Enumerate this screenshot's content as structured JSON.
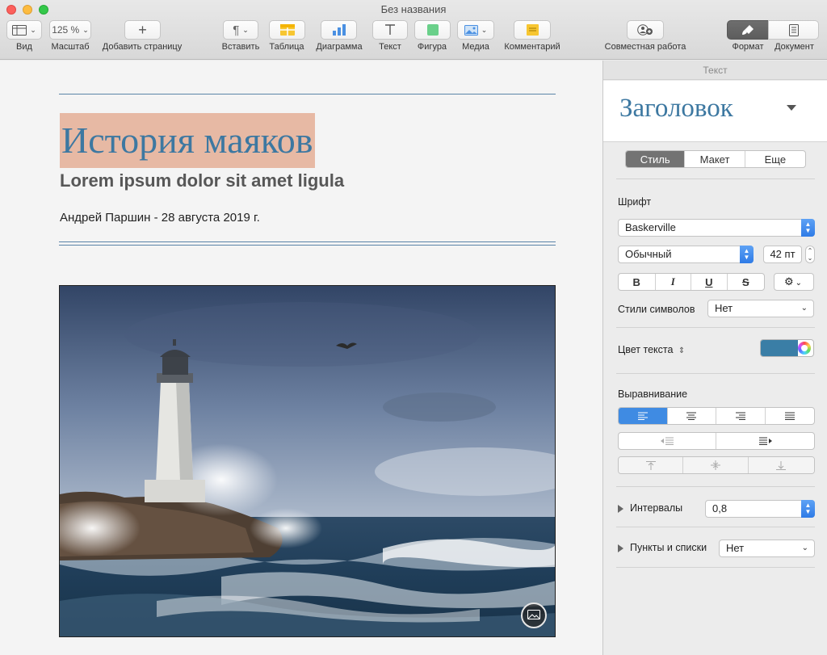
{
  "window": {
    "title": "Без названия"
  },
  "toolbar": {
    "view_label": "Вид",
    "zoom_value": "125 %",
    "zoom_label": "Масштаб",
    "add_page_label": "Добавить страницу",
    "insert_label": "Вставить",
    "table_label": "Таблица",
    "chart_label": "Диаграмма",
    "text_label": "Текст",
    "shape_label": "Фигура",
    "media_label": "Медиа",
    "comment_label": "Комментарий",
    "collab_label": "Совместная работа",
    "format_label": "Формат",
    "document_label": "Документ"
  },
  "document": {
    "title": "История маяков",
    "subtitle": "Lorem ipsum dolor sit amet ligula",
    "author_line": "Андрей Паршин - 28 августа 2019 г."
  },
  "inspector": {
    "header": "Текст",
    "paragraph_style": "Заголовок",
    "tabs": [
      "Стиль",
      "Макет",
      "Еще"
    ],
    "active_tab": 0,
    "font_section": "Шрифт",
    "font_family": "Baskerville",
    "font_style": "Обычный",
    "font_size": "42 пт",
    "bold": "B",
    "italic": "I",
    "underline": "U",
    "strike": "S",
    "char_styles_label": "Стили символов",
    "char_styles_value": "Нет",
    "text_color_label": "Цвет текста",
    "text_color": "#3a7ea6",
    "alignment_section": "Выравнивание",
    "spacing_label": "Интервалы",
    "spacing_value": "0,8",
    "lists_label": "Пункты и списки",
    "lists_value": "Нет"
  },
  "colors": {
    "accent": "#3d78a1",
    "title_highlight": "#e7b9a4",
    "selection_blue": "#3f8be3"
  }
}
